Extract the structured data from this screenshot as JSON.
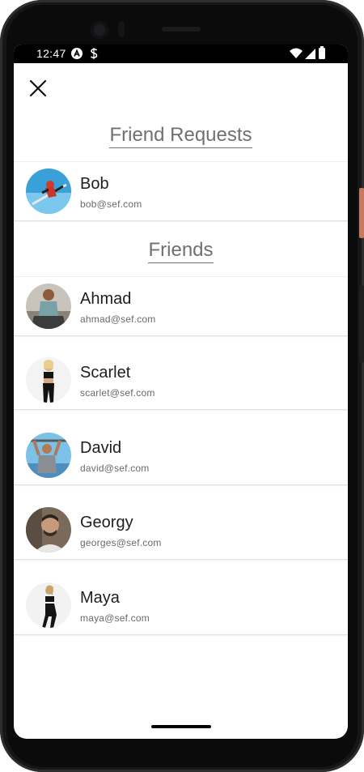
{
  "status_bar": {
    "time": "12:47"
  },
  "header": {
    "close_icon": "close-icon"
  },
  "sections": {
    "requests_title": "Friend Requests",
    "friends_title": "Friends"
  },
  "friend_requests": [
    {
      "name": "Bob",
      "email": "bob@sef.com"
    }
  ],
  "friends": [
    {
      "name": "Ahmad",
      "email": "ahmad@sef.com"
    },
    {
      "name": "Scarlet",
      "email": "scarlet@sef.com"
    },
    {
      "name": "David",
      "email": "david@sef.com"
    },
    {
      "name": "Georgy",
      "email": "georges@sef.com"
    },
    {
      "name": "Maya",
      "email": "maya@sef.com"
    }
  ],
  "colors": {
    "title": "#707070",
    "name": "#1e1e1e",
    "email": "#6a6a6a",
    "divider": "#e2e2e2"
  }
}
